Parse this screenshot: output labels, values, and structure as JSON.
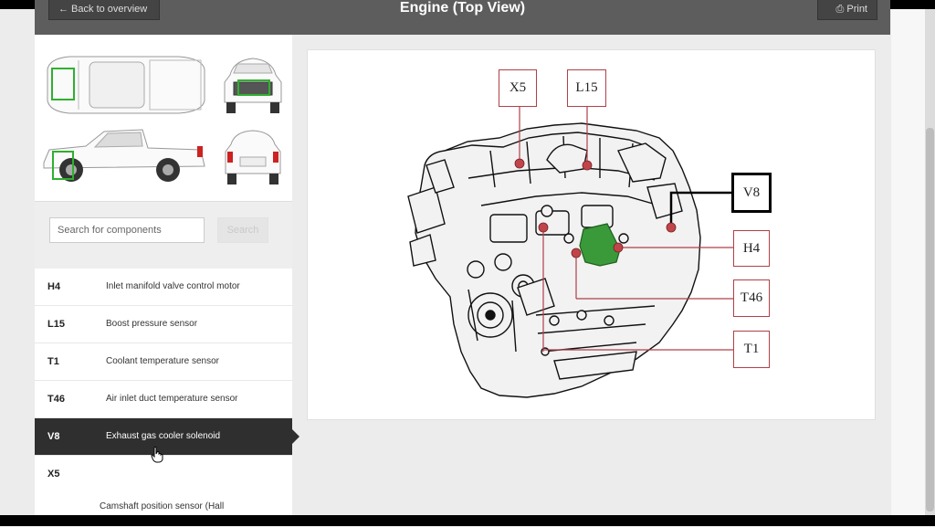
{
  "header": {
    "back_label": "← Back to overview",
    "title": "Engine (Top View)",
    "print_label": "⎙ Print"
  },
  "search": {
    "placeholder": "Search for components",
    "button_label": "Search"
  },
  "components": [
    {
      "code": "H4",
      "description": "Inlet manifold valve control motor"
    },
    {
      "code": "L15",
      "description": "Boost pressure sensor"
    },
    {
      "code": "T1",
      "description": "Coolant temperature sensor"
    },
    {
      "code": "T46",
      "description": "Air inlet duct temperature sensor"
    },
    {
      "code": "V8",
      "description": "Exhaust gas cooler solenoid",
      "selected": true
    },
    {
      "code": "X5",
      "description": "Camshaft position sensor (Hall Effect/MRE type)"
    }
  ],
  "diagram": {
    "labels": {
      "x5": "X5",
      "l15": "L15",
      "v8": "V8",
      "h4": "H4",
      "t46": "T46",
      "t1": "T1"
    },
    "active_label": "V8"
  },
  "colors": {
    "header_bg": "#5d5d5d",
    "selected_row_bg": "#2f2f2f",
    "callout_red": "#b04048",
    "highlight_green": "#3a9a3a"
  }
}
